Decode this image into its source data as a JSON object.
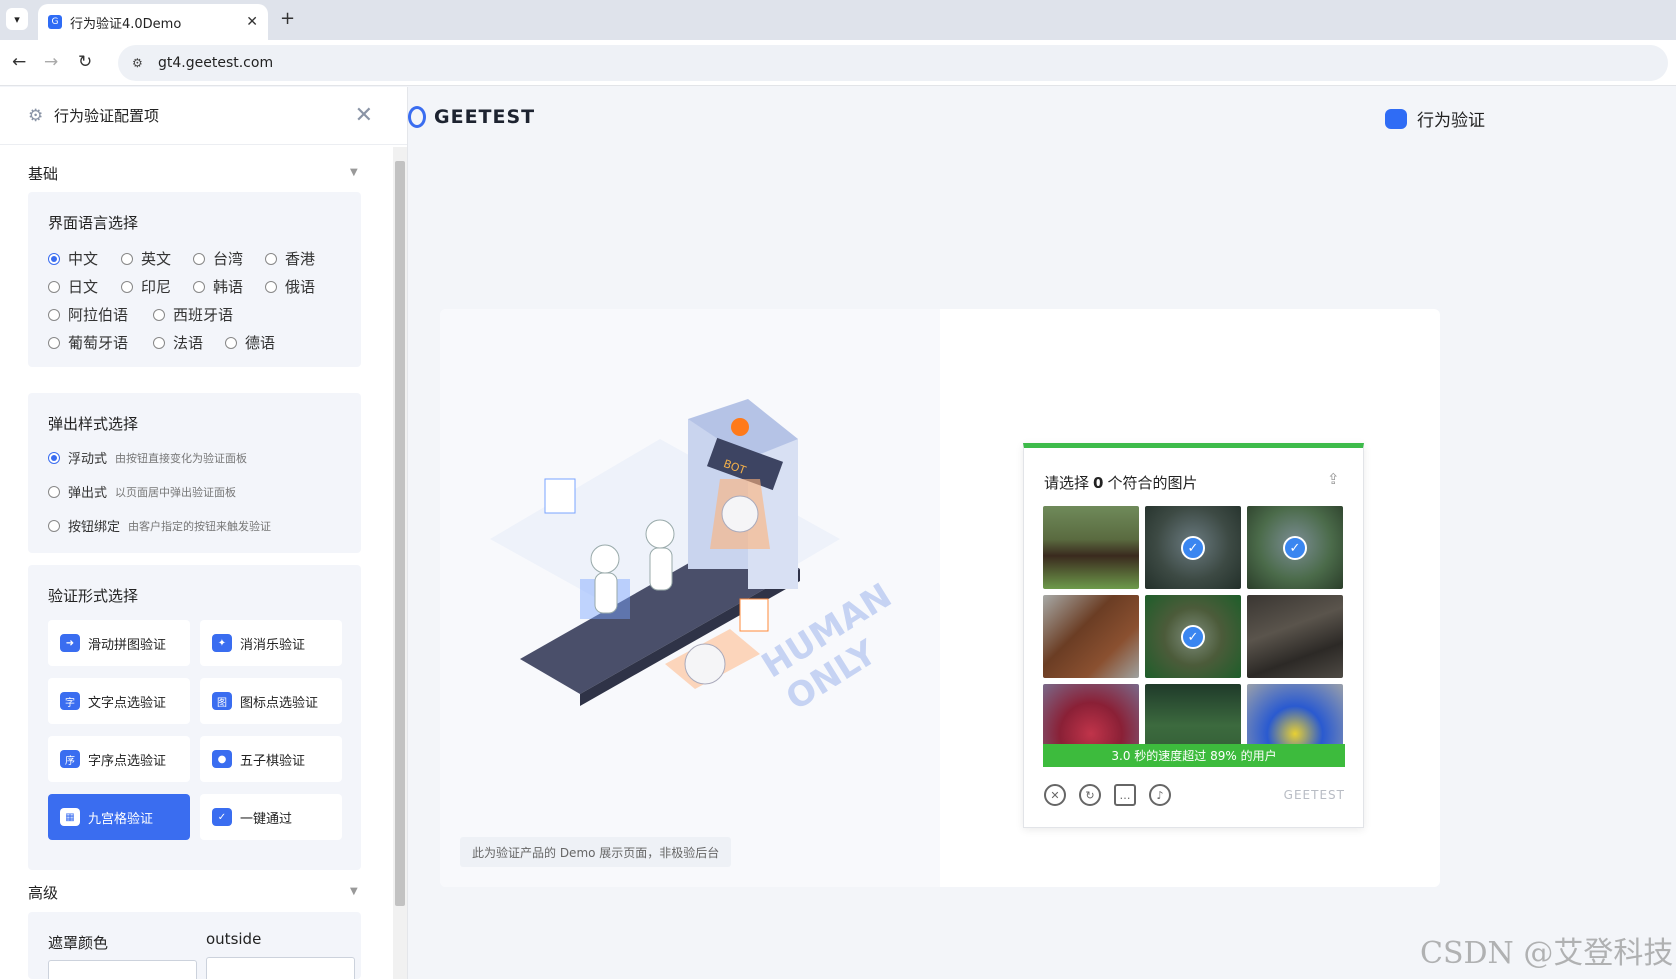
{
  "browser": {
    "tab_title": "行为验证4.0Demo",
    "tab_close": "✕",
    "new_tab": "+",
    "url": "gt4.geetest.com"
  },
  "sidebar": {
    "title": "行为验证配置项",
    "basic_section": "基础",
    "advanced_section": "高级",
    "language": {
      "title": "界面语言选择",
      "options": [
        "中文",
        "英文",
        "台湾",
        "香港",
        "日文",
        "印尼",
        "韩语",
        "俄语",
        "阿拉伯语",
        "西班牙语",
        "葡萄牙语",
        "法语",
        "德语"
      ],
      "selected": "中文"
    },
    "popup_style": {
      "title": "弹出样式选择",
      "options": [
        {
          "label": "浮动式",
          "desc": "由按钮直接变化为验证面板"
        },
        {
          "label": "弹出式",
          "desc": "以页面居中弹出验证面板"
        },
        {
          "label": "按钮绑定",
          "desc": "由客户指定的按钮来触发验证"
        }
      ],
      "selected": "浮动式"
    },
    "verify_type": {
      "title": "验证形式选择",
      "options": [
        "滑动拼图验证",
        "消消乐验证",
        "文字点选验证",
        "图标点选验证",
        "字序点选验证",
        "五子棋验证",
        "九宫格验证",
        "一键通过"
      ],
      "selected": "九宫格验证"
    },
    "advanced": {
      "mask_color_label": "遮罩颜色",
      "outside_label": "outside"
    }
  },
  "main": {
    "logo": "GEETEST",
    "product": "行为验证",
    "demo_note": "此为验证产品的 Demo 展示页面，非极验后台"
  },
  "captcha": {
    "title_prefix": "请选择",
    "count": "0",
    "title_suffix": "个符合的图片",
    "speed_text": "3.0 秒的速度超过 89% 的用户",
    "brand": "GEETEST",
    "checked_cells": [
      1,
      2,
      4
    ],
    "accent_color": "#3dbb3d"
  },
  "illustration": {
    "bot_label": "BOT",
    "slogan_line1": "HUMAN",
    "slogan_line2": "ONLY"
  },
  "watermark": "CSDN @艾登科技"
}
